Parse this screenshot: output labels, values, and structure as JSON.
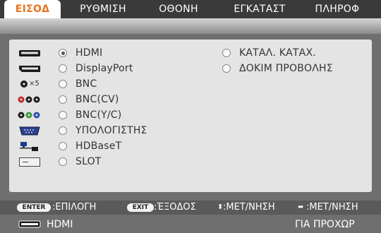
{
  "tabs": [
    {
      "label": "ΕΙΣΟΔ",
      "active": true
    },
    {
      "label": "ΡΥΘΜΙΣΗ",
      "active": false
    },
    {
      "label": "ΟΘΟΝΗ",
      "active": false
    },
    {
      "label": "ΕΓΚΑΤΑΣΤ",
      "active": false
    },
    {
      "label": "ΠΛΗΡΟΦ",
      "active": false
    }
  ],
  "inputs": [
    {
      "label": "HDMI",
      "icon": "hdmi-port-icon",
      "selected": true
    },
    {
      "label": "DisplayPort",
      "icon": "displayport-icon",
      "selected": false
    },
    {
      "label": "BNC",
      "icon": "bnc-connector-icon",
      "icon_text": "×5",
      "selected": false
    },
    {
      "label": "BNC(CV)",
      "icon": "bnc-composite-icon",
      "selected": false
    },
    {
      "label": "BNC(Y/C)",
      "icon": "bnc-svideo-icon",
      "selected": false
    },
    {
      "label": "ΥΠΟΛΟΓΙΣΤΗΣ",
      "icon": "vga-computer-icon",
      "selected": false
    },
    {
      "label": "HDBaseT",
      "icon": "network-lan-icon",
      "selected": false
    },
    {
      "label": "SLOT",
      "icon": "slot-card-icon",
      "selected": false
    }
  ],
  "right_options": [
    {
      "label": "ΚΑΤΑΛ. ΚΑΤΑΧ."
    },
    {
      "label": "ΔΟΚΙΜ ΠΡΟΒΟΛΗΣ"
    }
  ],
  "help": {
    "enter_key": "ENTER",
    "enter_text": ":ΕΠΙΛΟΓΗ",
    "exit_key": "EXIT",
    "exit_text": ":ΈΞΟΔΟΣ",
    "move_v_text": ":ΜΕΤ/ΝΗΣΗ",
    "move_h_text": ":ΜΕΤ/ΝΗΣΗ"
  },
  "status": {
    "source": "HDMI",
    "source_icon": "hdmi-port-icon",
    "right_text": "ΓΙΑ ΠΡΟΧΩΡ"
  },
  "colors": {
    "active_tab_text": "#e8731e",
    "bnc_red": "#c0282d",
    "bnc_green": "#3a9a3a",
    "bnc_blue": "#2a4fb0",
    "vga_blue": "#2c3f8c"
  }
}
